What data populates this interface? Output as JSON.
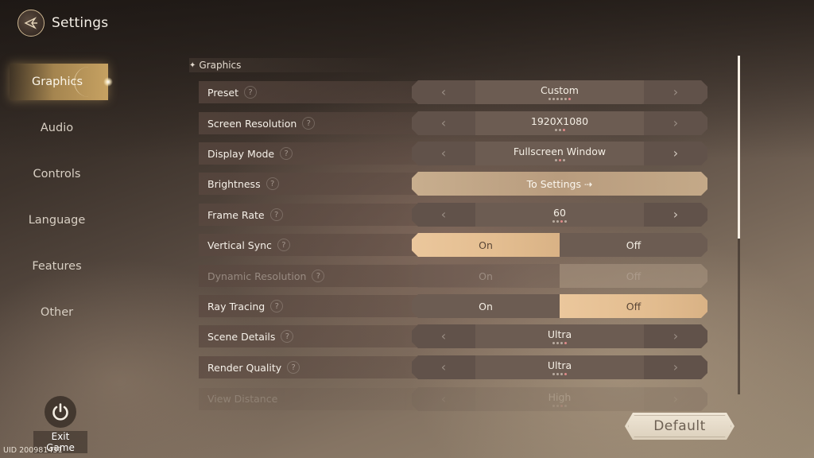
{
  "header": {
    "title": "Settings",
    "back_icon": "back-arrow-icon"
  },
  "sidebar": {
    "items": [
      {
        "label": "Graphics",
        "active": true
      },
      {
        "label": "Audio",
        "active": false
      },
      {
        "label": "Controls",
        "active": false
      },
      {
        "label": "Language",
        "active": false
      },
      {
        "label": "Features",
        "active": false
      },
      {
        "label": "Other",
        "active": false
      }
    ]
  },
  "section": {
    "title": "Graphics"
  },
  "settings": [
    {
      "label": "Preset",
      "type": "selector",
      "value": "Custom",
      "options_count": 6,
      "selected_index": 5,
      "left_enabled": false,
      "right_enabled": false
    },
    {
      "label": "Screen Resolution",
      "type": "selector",
      "value": "1920X1080",
      "options_count": 3,
      "selected_index": 2,
      "left_enabled": false,
      "right_enabled": false
    },
    {
      "label": "Display Mode",
      "type": "selector",
      "value": "Fullscreen Window",
      "options_count": 3,
      "selected_index": 1,
      "left_enabled": false,
      "right_enabled": true
    },
    {
      "label": "Brightness",
      "type": "link",
      "value": "To Settings ⇢"
    },
    {
      "label": "Frame Rate",
      "type": "selector",
      "value": "60",
      "options_count": 4,
      "selected_index": 2,
      "left_enabled": false,
      "right_enabled": true
    },
    {
      "label": "Vertical Sync",
      "type": "toggle",
      "on_label": "On",
      "off_label": "Off",
      "value": "On",
      "disabled": false
    },
    {
      "label": "Dynamic Resolution",
      "type": "toggle",
      "on_label": "On",
      "off_label": "Off",
      "value": "Off",
      "disabled": true
    },
    {
      "label": "Ray Tracing",
      "type": "toggle",
      "on_label": "On",
      "off_label": "Off",
      "value": "Off",
      "disabled": false
    },
    {
      "label": "Scene Details",
      "type": "selector",
      "value": "Ultra",
      "options_count": 4,
      "selected_index": 3,
      "left_enabled": false,
      "right_enabled": false
    },
    {
      "label": "Render Quality",
      "type": "selector",
      "value": "Ultra",
      "options_count": 4,
      "selected_index": 3,
      "left_enabled": false,
      "right_enabled": false
    },
    {
      "label": "View Distance",
      "type": "selector",
      "value": "High",
      "options_count": 4,
      "selected_index": 2,
      "left_enabled": false,
      "right_enabled": false,
      "partially_visible": true
    }
  ],
  "help_glyph": "?",
  "arrows": {
    "left": "‹",
    "right": "›"
  },
  "scroll": {
    "visible_fraction": 0.54,
    "position_fraction": 0.0
  },
  "footer": {
    "exit_label": "Exit Game",
    "exit_icon": "power-icon",
    "uid": "UID 200981431",
    "default_label": "Default"
  }
}
